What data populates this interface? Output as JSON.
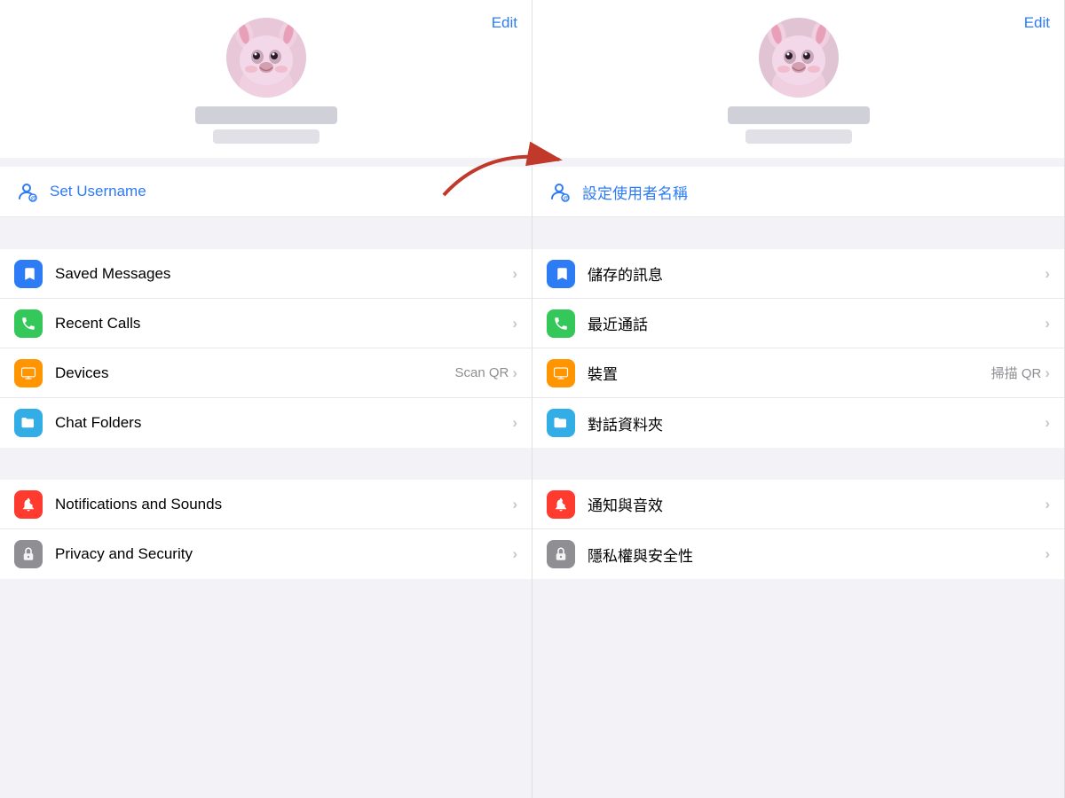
{
  "left": {
    "edit_label": "Edit",
    "username_label": "Set Username",
    "menu_groups": [
      {
        "items": [
          {
            "id": "saved-messages",
            "icon": "bookmark",
            "icon_class": "icon-blue",
            "label": "Saved Messages",
            "sub": "",
            "chevron": "›"
          },
          {
            "id": "recent-calls",
            "icon": "phone",
            "icon_class": "icon-green",
            "label": "Recent Calls",
            "sub": "",
            "chevron": "›"
          },
          {
            "id": "devices",
            "icon": "monitor",
            "icon_class": "icon-orange",
            "label": "Devices",
            "sub": "Scan QR",
            "chevron": "›"
          },
          {
            "id": "chat-folders",
            "icon": "folder",
            "icon_class": "icon-teal",
            "label": "Chat Folders",
            "sub": "",
            "chevron": "›"
          }
        ]
      },
      {
        "items": [
          {
            "id": "notifications",
            "icon": "bell",
            "icon_class": "icon-red",
            "label": "Notifications and Sounds",
            "sub": "",
            "chevron": "›"
          },
          {
            "id": "privacy",
            "icon": "lock",
            "icon_class": "icon-gray",
            "label": "Privacy and Security",
            "sub": "",
            "chevron": "›"
          }
        ]
      }
    ]
  },
  "right": {
    "edit_label": "Edit",
    "username_label": "設定使用者名稱",
    "menu_groups": [
      {
        "items": [
          {
            "id": "saved-messages-zh",
            "icon": "bookmark",
            "icon_class": "icon-blue",
            "label": "儲存的訊息",
            "sub": "",
            "chevron": "›"
          },
          {
            "id": "recent-calls-zh",
            "icon": "phone",
            "icon_class": "icon-green",
            "label": "最近通話",
            "sub": "",
            "chevron": "›"
          },
          {
            "id": "devices-zh",
            "icon": "monitor",
            "icon_class": "icon-orange",
            "label": "裝置",
            "sub": "掃描 QR",
            "chevron": "›"
          },
          {
            "id": "chat-folders-zh",
            "icon": "folder",
            "icon_class": "icon-teal",
            "label": "對話資料夾",
            "sub": "",
            "chevron": "›"
          }
        ]
      },
      {
        "items": [
          {
            "id": "notifications-zh",
            "icon": "bell",
            "icon_class": "icon-red",
            "label": "通知與音效",
            "sub": "",
            "chevron": "›"
          },
          {
            "id": "privacy-zh",
            "icon": "lock",
            "icon_class": "icon-gray",
            "label": "隱私權與安全性",
            "sub": "",
            "chevron": "›"
          }
        ]
      }
    ]
  }
}
